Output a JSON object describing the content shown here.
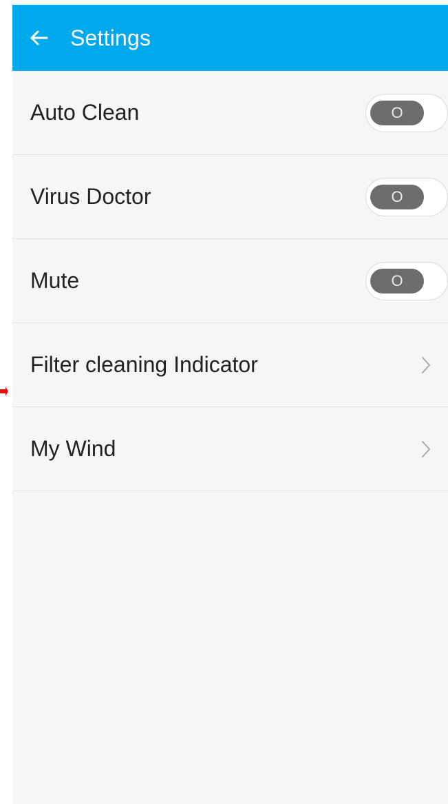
{
  "header": {
    "title": "Settings",
    "back_icon": "arrow-left-icon",
    "background_color": "#00a8ec"
  },
  "settings": {
    "toggles": [
      {
        "label": "Auto Clean",
        "state_text": "O",
        "on": false
      },
      {
        "label": "Virus Doctor",
        "state_text": "O",
        "on": false
      },
      {
        "label": "Mute",
        "state_text": "O",
        "on": false
      }
    ],
    "links": [
      {
        "label": "Filter cleaning Indicator",
        "icon": "chevron-right-icon"
      },
      {
        "label": "My Wind",
        "icon": "chevron-right-icon"
      }
    ]
  },
  "annotation": {
    "marker_icon": "red-arrow-icon",
    "marker_color": "#e01010"
  }
}
